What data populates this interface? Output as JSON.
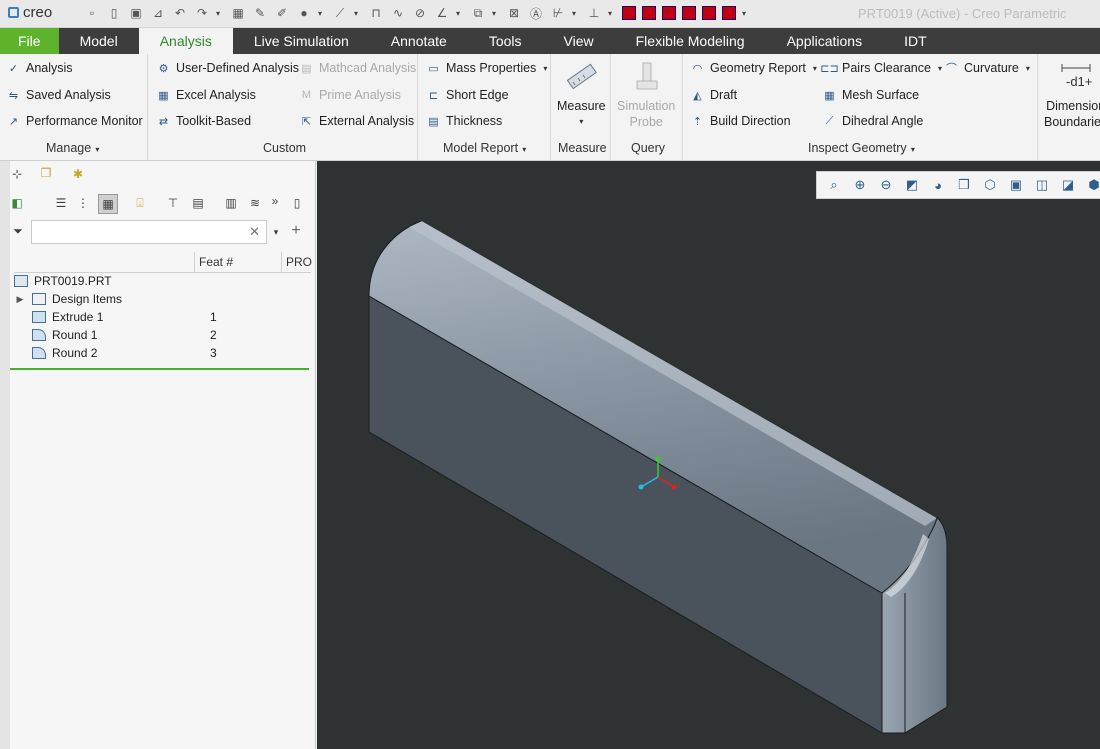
{
  "app": {
    "logo_text": "creo",
    "window_title": "PRT0019 (Active) - Creo Parametric"
  },
  "tabs": [
    {
      "label": "File"
    },
    {
      "label": "Model"
    },
    {
      "label": "Analysis"
    },
    {
      "label": "Live Simulation"
    },
    {
      "label": "Annotate"
    },
    {
      "label": "Tools"
    },
    {
      "label": "View"
    },
    {
      "label": "Flexible Modeling"
    },
    {
      "label": "Applications"
    },
    {
      "label": "IDT"
    }
  ],
  "active_tab": "Analysis",
  "ribbon": {
    "manage": {
      "label": "Manage",
      "items": [
        "Analysis",
        "Saved Analysis",
        "Performance Monitor"
      ]
    },
    "custom": {
      "label": "Custom",
      "items": [
        "User-Defined Analysis",
        "Excel Analysis",
        "Toolkit-Based",
        "Mathcad Analysis",
        "Prime Analysis",
        "External Analysis"
      ],
      "disabled": [
        "Mathcad Analysis",
        "Prime Analysis"
      ]
    },
    "model_report": {
      "label": "Model Report",
      "items": [
        "Mass Properties",
        "Short Edge",
        "Thickness"
      ]
    },
    "measure": {
      "label": "Measure",
      "button": "Measure"
    },
    "query": {
      "label": "Query",
      "button_line1": "Simulation",
      "button_line2": "Probe"
    },
    "inspect_geometry": {
      "label": "Inspect Geometry",
      "items": [
        "Geometry Report",
        "Draft",
        "Build Direction",
        "Pairs Clearance",
        "Mesh Surface",
        "Dihedral Angle",
        "Curvature"
      ]
    },
    "dimension": {
      "line1": "Dimension",
      "line2": "Boundaries"
    }
  },
  "model_tree": {
    "filter_placeholder": "",
    "columns": [
      "Feat #",
      "PRO"
    ],
    "rows": [
      {
        "label": "PRT0019.PRT",
        "feat": ""
      },
      {
        "label": "Design Items",
        "feat": ""
      },
      {
        "label": "Extrude 1",
        "feat": "1"
      },
      {
        "label": "Round 1",
        "feat": "2"
      },
      {
        "label": "Round 2",
        "feat": "3"
      }
    ]
  },
  "colors": {
    "file_tab": "#5db42c",
    "active_tab_text": "#2f8a2c",
    "tab_bar": "#3d3d3d",
    "graphics_bg": "#2f3232",
    "model_face": "#6f7a87",
    "insert_line": "#4caf2a"
  }
}
